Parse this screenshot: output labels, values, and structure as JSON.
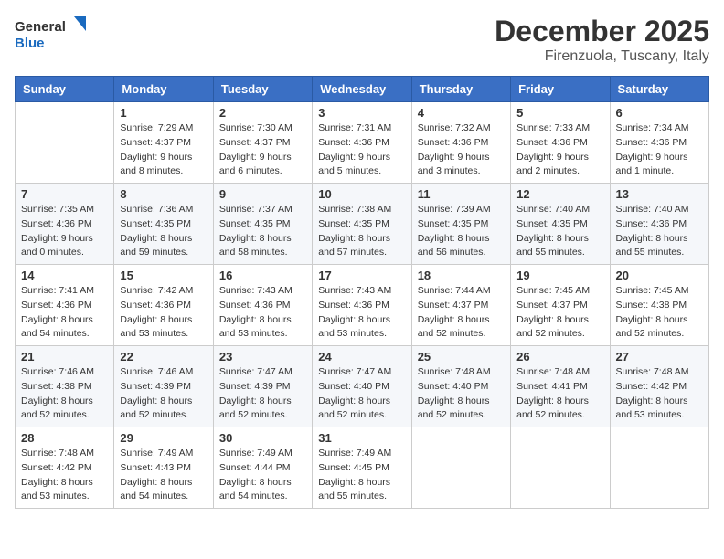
{
  "logo": {
    "line1": "General",
    "line2": "Blue"
  },
  "title": "December 2025",
  "location": "Firenzuola, Tuscany, Italy",
  "weekdays": [
    "Sunday",
    "Monday",
    "Tuesday",
    "Wednesday",
    "Thursday",
    "Friday",
    "Saturday"
  ],
  "weeks": [
    [
      {
        "day": "",
        "info": ""
      },
      {
        "day": "1",
        "info": "Sunrise: 7:29 AM\nSunset: 4:37 PM\nDaylight: 9 hours\nand 8 minutes."
      },
      {
        "day": "2",
        "info": "Sunrise: 7:30 AM\nSunset: 4:37 PM\nDaylight: 9 hours\nand 6 minutes."
      },
      {
        "day": "3",
        "info": "Sunrise: 7:31 AM\nSunset: 4:36 PM\nDaylight: 9 hours\nand 5 minutes."
      },
      {
        "day": "4",
        "info": "Sunrise: 7:32 AM\nSunset: 4:36 PM\nDaylight: 9 hours\nand 3 minutes."
      },
      {
        "day": "5",
        "info": "Sunrise: 7:33 AM\nSunset: 4:36 PM\nDaylight: 9 hours\nand 2 minutes."
      },
      {
        "day": "6",
        "info": "Sunrise: 7:34 AM\nSunset: 4:36 PM\nDaylight: 9 hours\nand 1 minute."
      }
    ],
    [
      {
        "day": "7",
        "info": "Sunrise: 7:35 AM\nSunset: 4:36 PM\nDaylight: 9 hours\nand 0 minutes."
      },
      {
        "day": "8",
        "info": "Sunrise: 7:36 AM\nSunset: 4:35 PM\nDaylight: 8 hours\nand 59 minutes."
      },
      {
        "day": "9",
        "info": "Sunrise: 7:37 AM\nSunset: 4:35 PM\nDaylight: 8 hours\nand 58 minutes."
      },
      {
        "day": "10",
        "info": "Sunrise: 7:38 AM\nSunset: 4:35 PM\nDaylight: 8 hours\nand 57 minutes."
      },
      {
        "day": "11",
        "info": "Sunrise: 7:39 AM\nSunset: 4:35 PM\nDaylight: 8 hours\nand 56 minutes."
      },
      {
        "day": "12",
        "info": "Sunrise: 7:40 AM\nSunset: 4:35 PM\nDaylight: 8 hours\nand 55 minutes."
      },
      {
        "day": "13",
        "info": "Sunrise: 7:40 AM\nSunset: 4:36 PM\nDaylight: 8 hours\nand 55 minutes."
      }
    ],
    [
      {
        "day": "14",
        "info": "Sunrise: 7:41 AM\nSunset: 4:36 PM\nDaylight: 8 hours\nand 54 minutes."
      },
      {
        "day": "15",
        "info": "Sunrise: 7:42 AM\nSunset: 4:36 PM\nDaylight: 8 hours\nand 53 minutes."
      },
      {
        "day": "16",
        "info": "Sunrise: 7:43 AM\nSunset: 4:36 PM\nDaylight: 8 hours\nand 53 minutes."
      },
      {
        "day": "17",
        "info": "Sunrise: 7:43 AM\nSunset: 4:36 PM\nDaylight: 8 hours\nand 53 minutes."
      },
      {
        "day": "18",
        "info": "Sunrise: 7:44 AM\nSunset: 4:37 PM\nDaylight: 8 hours\nand 52 minutes."
      },
      {
        "day": "19",
        "info": "Sunrise: 7:45 AM\nSunset: 4:37 PM\nDaylight: 8 hours\nand 52 minutes."
      },
      {
        "day": "20",
        "info": "Sunrise: 7:45 AM\nSunset: 4:38 PM\nDaylight: 8 hours\nand 52 minutes."
      }
    ],
    [
      {
        "day": "21",
        "info": "Sunrise: 7:46 AM\nSunset: 4:38 PM\nDaylight: 8 hours\nand 52 minutes."
      },
      {
        "day": "22",
        "info": "Sunrise: 7:46 AM\nSunset: 4:39 PM\nDaylight: 8 hours\nand 52 minutes."
      },
      {
        "day": "23",
        "info": "Sunrise: 7:47 AM\nSunset: 4:39 PM\nDaylight: 8 hours\nand 52 minutes."
      },
      {
        "day": "24",
        "info": "Sunrise: 7:47 AM\nSunset: 4:40 PM\nDaylight: 8 hours\nand 52 minutes."
      },
      {
        "day": "25",
        "info": "Sunrise: 7:48 AM\nSunset: 4:40 PM\nDaylight: 8 hours\nand 52 minutes."
      },
      {
        "day": "26",
        "info": "Sunrise: 7:48 AM\nSunset: 4:41 PM\nDaylight: 8 hours\nand 52 minutes."
      },
      {
        "day": "27",
        "info": "Sunrise: 7:48 AM\nSunset: 4:42 PM\nDaylight: 8 hours\nand 53 minutes."
      }
    ],
    [
      {
        "day": "28",
        "info": "Sunrise: 7:48 AM\nSunset: 4:42 PM\nDaylight: 8 hours\nand 53 minutes."
      },
      {
        "day": "29",
        "info": "Sunrise: 7:49 AM\nSunset: 4:43 PM\nDaylight: 8 hours\nand 54 minutes."
      },
      {
        "day": "30",
        "info": "Sunrise: 7:49 AM\nSunset: 4:44 PM\nDaylight: 8 hours\nand 54 minutes."
      },
      {
        "day": "31",
        "info": "Sunrise: 7:49 AM\nSunset: 4:45 PM\nDaylight: 8 hours\nand 55 minutes."
      },
      {
        "day": "",
        "info": ""
      },
      {
        "day": "",
        "info": ""
      },
      {
        "day": "",
        "info": ""
      }
    ]
  ]
}
